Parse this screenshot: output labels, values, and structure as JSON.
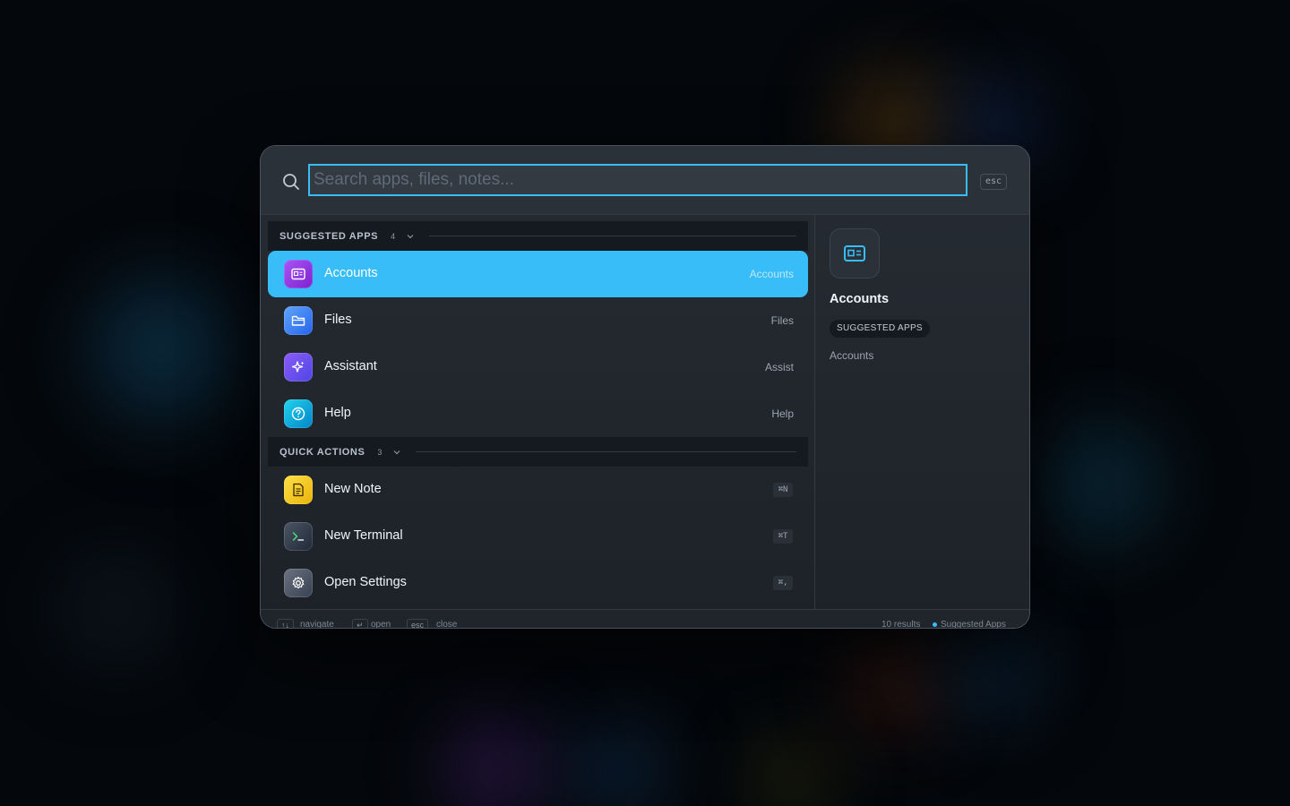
{
  "search": {
    "placeholder": "Search apps, files, notes...",
    "esc_label": "esc"
  },
  "sections": [
    {
      "title": "SUGGESTED APPS",
      "count": "4",
      "items": [
        {
          "label": "Accounts",
          "right": "Accounts",
          "icon": "id-card-icon",
          "color": "#9333ea"
        },
        {
          "label": "Files",
          "right": "Files",
          "icon": "folder-icon",
          "color": "#3b82f6"
        },
        {
          "label": "Assistant",
          "right": "Assist",
          "icon": "sparkle-icon",
          "color": "#6366f1"
        },
        {
          "label": "Help",
          "right": "Help",
          "icon": "help-circle-icon",
          "color": "#0ea5e9"
        }
      ]
    },
    {
      "title": "QUICK ACTIONS",
      "count": "3",
      "items": [
        {
          "label": "New Note",
          "shortcut": "⌘N",
          "icon": "note-icon",
          "color": "#eab308"
        },
        {
          "label": "New Terminal",
          "shortcut": "⌘T",
          "icon": "terminal-icon",
          "color": "#374151"
        },
        {
          "label": "Open Settings",
          "shortcut": "⌘,",
          "icon": "gear-icon",
          "color": "#4b5563"
        }
      ]
    }
  ],
  "preview": {
    "title": "Accounts",
    "tag": "SUGGESTED APPS",
    "subtitle": "Accounts",
    "icon": "id-card-icon"
  },
  "footer": {
    "navigate_key": "↑↓",
    "navigate_label": "navigate",
    "open_key": "↵",
    "open_label": "open",
    "close_key": "esc",
    "close_label": "close",
    "results": "10 results",
    "context": "Suggested Apps"
  },
  "colors": {
    "accent": "#38bdf8"
  }
}
